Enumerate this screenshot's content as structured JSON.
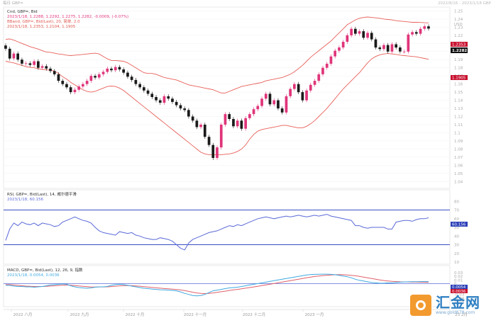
{
  "header": {
    "top_left": "每日 GBP=",
    "top_right": "2022/8/16 - 2023/1/18 GBP"
  },
  "chart_data": [
    {
      "id": "price",
      "type": "candlestick",
      "title": "Cnd, GBP=, Bid",
      "info": "2023/1/18, 1.2288, 1.2292, 1.2275, 1.2282, -0.0009, (-0.07%)",
      "bband_title": "BBand, GBP=, Bid(Last), 20, 简单, 2.0",
      "bband_info": "2023/1/18, 1.2353, 1.2104, 1.1905",
      "ylabel": "USD",
      "ylim": [
        1.035,
        1.253
      ],
      "yticks": [
        "1.25",
        "1.24",
        "1.23",
        "1.22",
        "1.21",
        "1.2",
        "1.19",
        "1.18",
        "1.17",
        "1.16",
        "1.15",
        "1.14",
        "1.13",
        "1.12",
        "1.11",
        "1.1",
        "1.09",
        "1.08",
        "1.07",
        "1.06",
        "1.05",
        "1.04"
      ],
      "last_price_label": "1.2282",
      "upper_band_label": "1.2353",
      "lower_band_label": "1.1905",
      "colors": {
        "up": "#e0357a",
        "down": "#1a1a1a",
        "band": "#e8605a"
      },
      "close": [
        1.2035,
        1.1915,
        1.1975,
        1.19,
        1.185,
        1.1855,
        1.1835,
        1.188,
        1.18,
        1.182,
        1.179,
        1.176,
        1.172,
        1.164,
        1.16,
        1.156,
        1.15,
        1.153,
        1.157,
        1.16,
        1.164,
        1.17,
        1.168,
        1.172,
        1.175,
        1.179,
        1.177,
        1.181,
        1.178,
        1.174,
        1.169,
        1.165,
        1.16,
        1.156,
        1.152,
        1.148,
        1.144,
        1.14,
        1.137,
        1.145,
        1.142,
        1.138,
        1.134,
        1.13,
        1.128,
        1.12,
        1.115,
        1.107,
        1.11,
        1.095,
        1.085,
        1.069,
        1.082,
        1.11,
        1.123,
        1.117,
        1.108,
        1.115,
        1.105,
        1.118,
        1.123,
        1.129,
        1.133,
        1.142,
        1.148,
        1.135,
        1.14,
        1.13,
        1.125,
        1.145,
        1.154,
        1.16,
        1.15,
        1.14,
        1.152,
        1.159,
        1.164,
        1.172,
        1.18,
        1.185,
        1.194,
        1.201,
        1.205,
        1.212,
        1.22,
        1.228,
        1.222,
        1.225,
        1.217,
        1.223,
        1.215,
        1.205,
        1.203,
        1.208,
        1.2,
        1.209,
        1.205,
        1.2,
        1.2,
        1.221,
        1.224,
        1.222,
        1.228,
        1.231,
        1.2282
      ],
      "upper": [
        1.215,
        1.2155,
        1.214,
        1.212,
        1.21,
        1.208,
        1.206,
        1.2045,
        1.203,
        1.201,
        1.1995,
        1.199,
        1.198,
        1.197,
        1.1965,
        1.1955,
        1.195,
        1.1955,
        1.196,
        1.1965,
        1.197,
        1.1975,
        1.198,
        1.197,
        1.194,
        1.191,
        1.189,
        1.189,
        1.1885,
        1.188,
        1.186,
        1.183,
        1.18,
        1.177,
        1.174,
        1.173,
        1.173,
        1.172,
        1.17,
        1.168,
        1.167,
        1.166,
        1.165,
        1.163,
        1.161,
        1.159,
        1.158,
        1.157,
        1.156,
        1.155,
        1.154,
        1.153,
        1.151,
        1.149,
        1.149,
        1.151,
        1.153,
        1.155,
        1.157,
        1.158,
        1.159,
        1.16,
        1.161,
        1.162,
        1.164,
        1.165,
        1.166,
        1.167,
        1.168,
        1.17,
        1.172,
        1.175,
        1.179,
        1.183,
        1.188,
        1.193,
        1.197,
        1.201,
        1.205,
        1.209,
        1.213,
        1.218,
        1.223,
        1.228,
        1.233,
        1.236,
        1.239,
        1.241,
        1.242,
        1.2425,
        1.242,
        1.2415,
        1.241,
        1.24,
        1.2395,
        1.239,
        1.238,
        1.2375,
        1.237,
        1.2365,
        1.236,
        1.236,
        1.2358,
        1.2355,
        1.2353
      ],
      "lower": [
        1.188,
        1.187,
        1.186,
        1.1845,
        1.183,
        1.1815,
        1.1805,
        1.18,
        1.179,
        1.178,
        1.1775,
        1.177,
        1.176,
        1.173,
        1.169,
        1.166,
        1.162,
        1.159,
        1.156,
        1.153,
        1.151,
        1.15,
        1.151,
        1.153,
        1.155,
        1.157,
        1.1575,
        1.157,
        1.155,
        1.152,
        1.148,
        1.144,
        1.14,
        1.136,
        1.132,
        1.128,
        1.124,
        1.12,
        1.116,
        1.112,
        1.108,
        1.104,
        1.1,
        1.096,
        1.092,
        1.088,
        1.084,
        1.08,
        1.076,
        1.074,
        1.073,
        1.073,
        1.073,
        1.073,
        1.0735,
        1.074,
        1.075,
        1.077,
        1.08,
        1.085,
        1.092,
        1.098,
        1.102,
        1.104,
        1.105,
        1.106,
        1.107,
        1.108,
        1.109,
        1.109,
        1.108,
        1.107,
        1.106,
        1.106,
        1.108,
        1.111,
        1.115,
        1.12,
        1.125,
        1.13,
        1.136,
        1.142,
        1.148,
        1.154,
        1.159,
        1.164,
        1.169,
        1.174,
        1.18,
        1.186,
        1.191,
        1.194,
        1.196,
        1.197,
        1.1975,
        1.197,
        1.1965,
        1.1955,
        1.195,
        1.1945,
        1.194,
        1.1935,
        1.1925,
        1.1915,
        1.1905
      ]
    },
    {
      "id": "rsi",
      "type": "line",
      "title": "RSI, GBP=, Bid(Last), 14, 威尔德平滑",
      "info": "2023/1/18, 60.156",
      "last_label": "60.156",
      "ylim": [
        10,
        90
      ],
      "levels": [
        70,
        30
      ],
      "yticks": [
        "80",
        "70",
        "60",
        "50",
        "40",
        "30",
        "20",
        "10"
      ],
      "colors": {
        "line": "#5a6ad8",
        "level": "#3a4fc4"
      },
      "values": [
        35,
        48,
        55,
        52,
        56,
        54,
        53,
        55,
        52,
        55,
        54,
        53,
        51,
        52,
        56,
        58,
        60,
        62,
        60,
        58,
        57,
        55,
        50,
        46,
        44,
        43,
        42,
        41,
        45,
        44,
        43,
        44,
        41,
        40,
        38,
        37,
        36,
        36,
        38,
        37,
        36,
        34,
        30,
        26,
        24,
        32,
        36,
        38,
        40,
        42,
        44,
        45,
        46,
        48,
        50,
        52,
        51,
        53,
        52,
        54,
        56,
        58,
        60,
        61,
        62,
        61,
        60,
        61,
        62,
        63,
        62,
        63,
        64,
        63,
        62,
        63,
        64,
        63,
        64,
        65,
        63,
        62,
        61,
        60,
        59,
        58,
        52,
        52,
        50,
        49,
        50,
        50,
        50,
        50,
        48,
        48,
        56,
        57,
        58,
        58,
        57,
        59,
        60,
        60,
        61
      ]
    },
    {
      "id": "macd",
      "type": "line",
      "title": "MACD, GBP=, Bid(Last), 12, 26, 9, 指数",
      "info": "2023/1/18, 0.0054, 0.0036",
      "macd_label": "0.0054",
      "signal_label": "0.0036",
      "ylim": [
        -0.06,
        0.04
      ],
      "yticks": [
        "0.03",
        "0.02",
        "0.01",
        "0",
        "-0.01",
        "-0.02",
        "-0.03",
        "-0.04",
        "-0.05"
      ],
      "colors": {
        "macd": "#3fa9e0",
        "signal": "#e0606a",
        "zero": "#5a6ad8"
      },
      "macd": [
        -0.005,
        -0.005,
        -0.007,
        -0.008,
        -0.008,
        -0.009,
        -0.009,
        -0.01,
        -0.009,
        -0.008,
        -0.006,
        -0.004,
        -0.003,
        -0.002,
        -0.001,
        -0.002,
        -0.006,
        -0.009,
        -0.011,
        -0.012,
        -0.013,
        -0.012,
        -0.01,
        -0.009,
        -0.009,
        -0.008,
        -0.005,
        -0.003,
        -0.002,
        -0.003,
        -0.005,
        -0.007,
        -0.009,
        -0.011,
        -0.013,
        -0.014,
        -0.015,
        -0.016,
        -0.017,
        -0.0175,
        -0.018,
        -0.019,
        -0.02,
        -0.023,
        -0.027,
        -0.03,
        -0.033,
        -0.034,
        -0.033,
        -0.03,
        -0.025,
        -0.02,
        -0.018,
        -0.016,
        -0.014,
        -0.012,
        -0.011,
        -0.01,
        -0.008,
        -0.006,
        -0.004,
        -0.002,
        0.0,
        0.002,
        0.004,
        0.006,
        0.008,
        0.01,
        0.012,
        0.014,
        0.016,
        0.018,
        0.02,
        0.022,
        0.024,
        0.025,
        0.0255,
        0.0258,
        0.026,
        0.026,
        0.0255,
        0.0245,
        0.023,
        0.021,
        0.019,
        0.016,
        0.012,
        0.009,
        0.007,
        0.005,
        0.003,
        0.002,
        0.001,
        0.001,
        0.002,
        0.002,
        0.003,
        0.004,
        0.0045,
        0.005,
        0.0052,
        0.0053,
        0.0054,
        0.0054,
        0.0054
      ],
      "signal": [
        -0.003,
        -0.003,
        -0.004,
        -0.005,
        -0.006,
        -0.007,
        -0.0075,
        -0.008,
        -0.008,
        -0.008,
        -0.0075,
        -0.0068,
        -0.006,
        -0.0052,
        -0.0044,
        -0.004,
        -0.0045,
        -0.0054,
        -0.0065,
        -0.0075,
        -0.0085,
        -0.0093,
        -0.0094,
        -0.0093,
        -0.0092,
        -0.009,
        -0.0082,
        -0.0072,
        -0.0062,
        -0.0056,
        -0.0055,
        -0.0058,
        -0.0064,
        -0.0073,
        -0.0085,
        -0.0096,
        -0.0107,
        -0.0117,
        -0.0128,
        -0.0137,
        -0.0146,
        -0.0154,
        -0.0163,
        -0.0177,
        -0.0195,
        -0.0216,
        -0.0239,
        -0.0259,
        -0.0273,
        -0.0278,
        -0.0272,
        -0.0258,
        -0.0242,
        -0.0226,
        -0.0209,
        -0.0191,
        -0.0175,
        -0.016,
        -0.0144,
        -0.0127,
        -0.011,
        -0.0092,
        -0.0074,
        -0.0055,
        -0.0036,
        -0.0017,
        0.0002,
        0.0022,
        0.0042,
        0.0062,
        0.0082,
        0.0102,
        0.0122,
        0.0142,
        0.0162,
        0.018,
        0.0196,
        0.021,
        0.0222,
        0.0232,
        0.024,
        0.0245,
        0.0247,
        0.0245,
        0.024,
        0.023,
        0.0216,
        0.0198,
        0.018,
        0.016,
        0.014,
        0.012,
        0.01,
        0.0085,
        0.0072,
        0.0062,
        0.0055,
        0.005,
        0.0047,
        0.0045,
        0.0043,
        0.0041,
        0.0039,
        0.0037,
        0.0036
      ]
    }
  ],
  "x_axis_labels": [
    "2022 八月",
    "2022 九月",
    "2022 十月",
    "2022 十一月",
    "2022 十二月",
    "2023 一月",
    "23 2月"
  ],
  "watermark": {
    "name": "汇金网",
    "url": "www.gold678.com"
  }
}
